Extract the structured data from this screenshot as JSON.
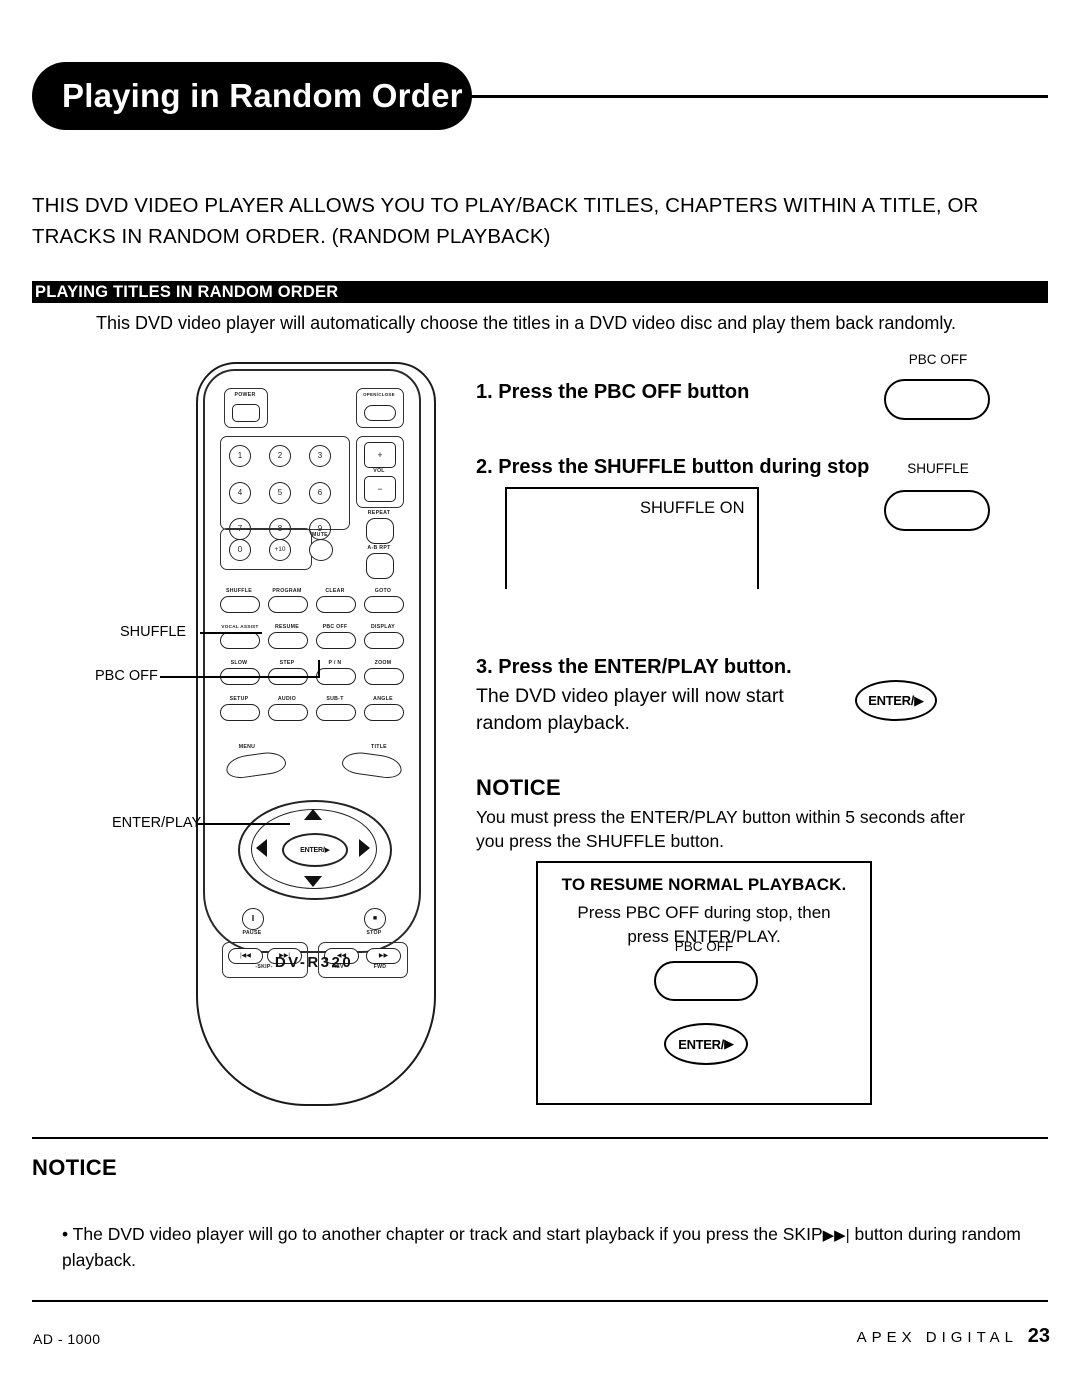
{
  "header": {
    "title": "Playing in Random Order"
  },
  "intro": {
    "line1": "THIS DVD VIDEO PLAYER ALLOWS YOU TO PLAY/BACK TITLES, CHAPTERS WITHIN A TITLE, OR",
    "line2": "TRACKS IN RANDOM ORDER.  (RANDOM PLAYBACK)"
  },
  "section": {
    "bar_title": "PLAYING TITLES IN RANDOM ORDER",
    "subtitle": "This DVD video player will automatically choose the titles in a DVD video disc and play them back randomly."
  },
  "steps": {
    "step1": "1. Press the PBC OFF button",
    "step2": "2. Press the SHUFFLE button during stop",
    "step3": "3. Press the ENTER/PLAY button.",
    "step3_body_l1": "The DVD video player will now start",
    "step3_body_l2": "random playback."
  },
  "osd": {
    "shuffle_on": "SHUFFLE ON"
  },
  "button_illustrations": {
    "pbc_off_label": "PBC OFF",
    "shuffle_label": "SHUFFLE",
    "enter_play_label": "ENTER/",
    "play_glyph": "▶",
    "resume_pbc_off_label": "PBC OFF"
  },
  "notice_top": {
    "heading": "NOTICE",
    "line1": "You must press the ENTER/PLAY button within 5 seconds after",
    "line2": " you press the SHUFFLE button."
  },
  "resume_box": {
    "heading": "TO RESUME NORMAL PLAYBACK.",
    "line1": "Press PBC OFF during stop, then",
    "line2": "press ENTER/PLAY."
  },
  "notice_bottom": {
    "heading": "NOTICE",
    "bullet_pre": "• The DVD video player will go to another chapter or track and start playback if you press the SKIP",
    "skip_glyph": "▶▶|",
    "bullet_post": " button during random playback."
  },
  "remote_callouts": {
    "shuffle": "SHUFFLE",
    "pbc_off": "PBC OFF",
    "enter_play": "ENTER/PLAY"
  },
  "remote": {
    "model": "DV-R320",
    "power": "POWER",
    "open_close": "OPEN/CLOSE",
    "vol": "VOL",
    "vol_plus": "+",
    "vol_minus": "−",
    "repeat": "REPEAT",
    "ab_rpt": "A-B RPT",
    "mute": "MUTE",
    "numbers": [
      "1",
      "2",
      "3",
      "4",
      "5",
      "6",
      "7",
      "8",
      "9",
      "0",
      "+10"
    ],
    "grid_rows": [
      [
        "SHUFFLE",
        "PROGRAM",
        "CLEAR",
        "GOTO"
      ],
      [
        "VOCAL ASSIST",
        "RESUME",
        "PBC OFF",
        "DISPLAY"
      ],
      [
        "SLOW",
        "STEP",
        "P / N",
        "ZOOM"
      ],
      [
        "SETUP",
        "AUDIO",
        "SUB-T",
        "ANGLE"
      ]
    ],
    "menu": "MENU",
    "title_btn": "TITLE",
    "enter_center": "ENTER/",
    "pause": "PAUSE",
    "pause_glyph": "‖",
    "stop": "STOP",
    "stop_glyph": "■",
    "skip": "-SKIP-",
    "skip_prev_glyph": "|◀◀",
    "skip_next_glyph": "▶▶|",
    "rev": "REV",
    "rev_glyph": "◀◀",
    "fwd": "FWD",
    "fwd_glyph": "▶▶"
  },
  "footer": {
    "left": "AD - 1000",
    "brand": "APEX DIGITAL",
    "page": "23"
  }
}
